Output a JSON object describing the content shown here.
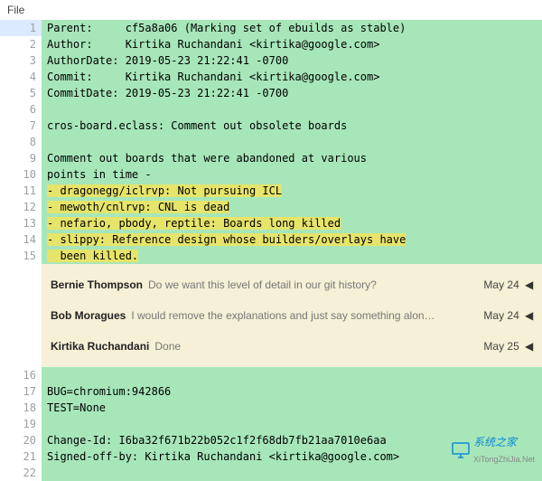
{
  "menu": {
    "file": "File"
  },
  "lines": [
    {
      "n": 1,
      "text": "Parent:     cf5a8a06 (Marking set of ebuilds as stable)",
      "hl": false,
      "current": true
    },
    {
      "n": 2,
      "text": "Author:     Kirtika Ruchandani <kirtika@google.com>",
      "hl": false,
      "current": false
    },
    {
      "n": 3,
      "text": "AuthorDate: 2019-05-23 21:22:41 -0700",
      "hl": false,
      "current": false
    },
    {
      "n": 4,
      "text": "Commit:     Kirtika Ruchandani <kirtika@google.com>",
      "hl": false,
      "current": false
    },
    {
      "n": 5,
      "text": "CommitDate: 2019-05-23 21:22:41 -0700",
      "hl": false,
      "current": false
    },
    {
      "n": 6,
      "text": "",
      "hl": false,
      "current": false
    },
    {
      "n": 7,
      "text": "cros-board.eclass: Comment out obsolete boards",
      "hl": false,
      "current": false
    },
    {
      "n": 8,
      "text": "",
      "hl": false,
      "current": false
    },
    {
      "n": 9,
      "text": "Comment out boards that were abandoned at various",
      "hl": false,
      "current": false
    },
    {
      "n": 10,
      "text": "points in time -",
      "hl": false,
      "current": false
    },
    {
      "n": 11,
      "text": "- dragonegg/iclrvp: Not pursuing ICL",
      "hl": true,
      "current": false
    },
    {
      "n": 12,
      "text": "- mewoth/cnlrvp: CNL is dead",
      "hl": true,
      "current": false
    },
    {
      "n": 13,
      "text": "- nefario, pbody, reptile: Boards long killed",
      "hl": true,
      "current": false
    },
    {
      "n": 14,
      "text": "- slippy: Reference design whose builders/overlays have",
      "hl": true,
      "current": false
    },
    {
      "n": 15,
      "text": "  been killed.",
      "hl": true,
      "current": false
    }
  ],
  "comments": [
    {
      "author": "Bernie Thompson",
      "msg": "Do we want this level of detail in our git history?",
      "date": "May 24"
    },
    {
      "author": "Bob Moragues",
      "msg": "I would remove the explanations and just say something alon…",
      "date": "May 24"
    },
    {
      "author": "Kirtika Ruchandani",
      "msg": "Done",
      "date": "May 25"
    }
  ],
  "lines2": [
    {
      "n": 16,
      "text": "",
      "hl": false
    },
    {
      "n": 17,
      "text": "BUG=chromium:942866",
      "hl": false
    },
    {
      "n": 18,
      "text": "TEST=None",
      "hl": false
    },
    {
      "n": 19,
      "text": "",
      "hl": false
    },
    {
      "n": 20,
      "text": "Change-Id: I6ba32f671b22b052c1f2f68db7fb21aa7010e6aa",
      "hl": false
    },
    {
      "n": 21,
      "text": "Signed-off-by: Kirtika Ruchandani <kirtika@google.com>",
      "hl": false
    },
    {
      "n": 22,
      "text": "",
      "hl": false
    }
  ],
  "watermark": {
    "text": "系统之家",
    "sub": "XiTongZhiJia.Net"
  }
}
